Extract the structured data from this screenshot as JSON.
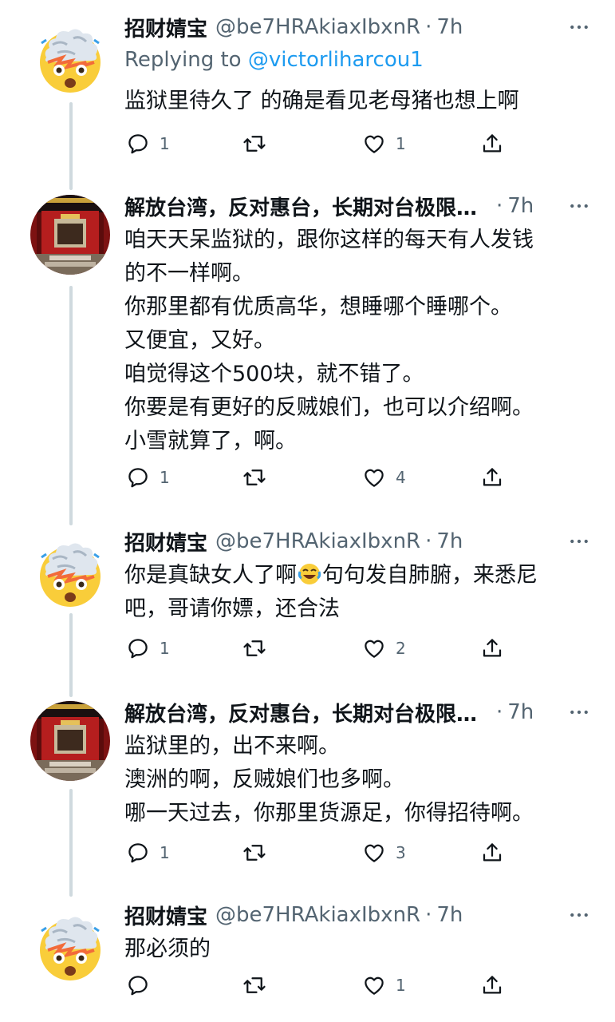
{
  "tweets": [
    {
      "name": "招财婧宝",
      "handle": "@be7HRAkiaxIbxnR",
      "dot": "·",
      "time": "7h",
      "replying_prefix": "Replying to ",
      "replying_to": "@victorliharcou1",
      "text": "监狱里待久了 的确是看见老母猪也想上啊",
      "replies": "1",
      "retweets": "",
      "likes": "1",
      "avatar_icon": "exploding-head-emoji-icon"
    },
    {
      "name": "解放台湾，反对惠台，长期对台极限施压",
      "handle": "",
      "dot": "·",
      "time": "7h",
      "text": "咱天天呆监狱的，跟你这样的每天有人发钱\n的不一样啊。\n你那里都有优质高华，想睡哪个睡哪个。\n又便宜，又好。\n咱觉得这个500块，就不错了。\n你要是有更好的反贼娘们，也可以介绍啊。\n小雪就算了，啊。",
      "replies": "1",
      "retweets": "",
      "likes": "4",
      "avatar_icon": "red-palace-gate-avatar-icon"
    },
    {
      "name": "招财婧宝",
      "handle": "@be7HRAkiaxIbxnR",
      "dot": "·",
      "time": "7h",
      "text_before_emoji": "你是真缺女人了啊",
      "inline_emoji": "face-with-tears-of-joy-icon",
      "text_after_emoji": "句句发自肺腑，来悉尼\n吧，哥请你嫖，还合法",
      "replies": "1",
      "retweets": "",
      "likes": "2",
      "avatar_icon": "exploding-head-emoji-icon"
    },
    {
      "name": "解放台湾，反对惠台，长期对台极限施压",
      "handle": "",
      "dot": "·",
      "time": "7h",
      "text": "监狱里的，出不来啊。\n澳洲的啊，反贼娘们也多啊。\n哪一天过去，你那里货源足，你得招待啊。",
      "replies": "1",
      "retweets": "",
      "likes": "3",
      "avatar_icon": "red-palace-gate-avatar-icon"
    },
    {
      "name": "招财婧宝",
      "handle": "@be7HRAkiaxIbxnR",
      "dot": "·",
      "time": "7h",
      "text": "那必须的",
      "replies": "",
      "retweets": "",
      "likes": "1",
      "avatar_icon": "exploding-head-emoji-icon"
    }
  ],
  "colors": {
    "text": "#0f1419",
    "secondary": "#536471",
    "link": "#1d9bf0",
    "thread_line": "#cfd9de"
  }
}
